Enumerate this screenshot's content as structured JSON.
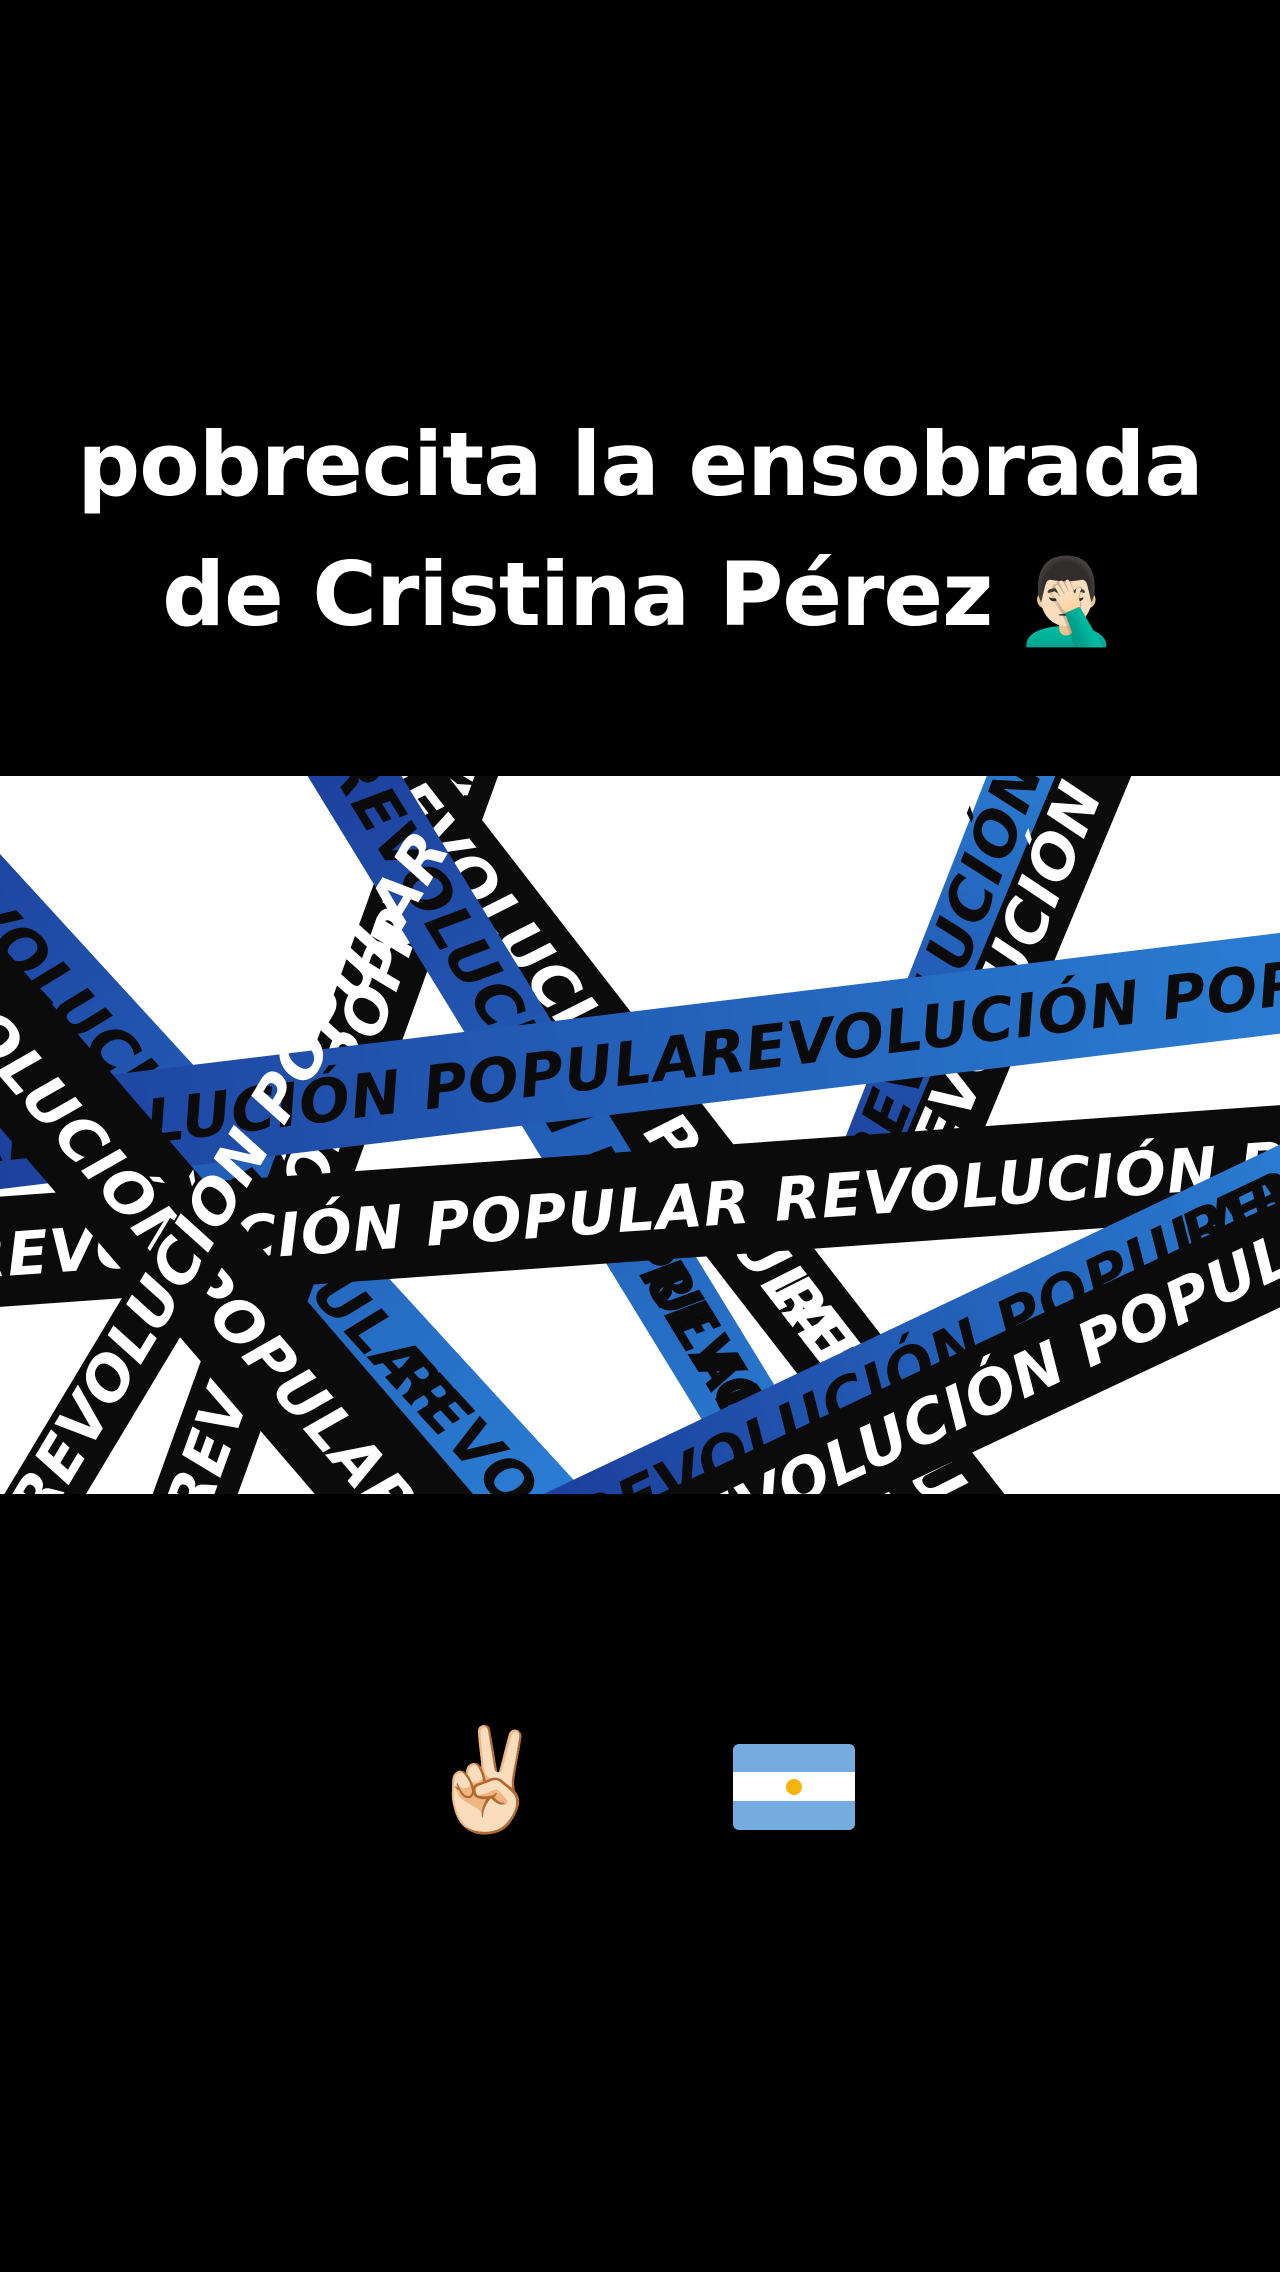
{
  "caption": {
    "line1": "pobrecita la ensobrada",
    "line2": "de Cristina Pérez",
    "emoji": "🤦🏻‍♂️"
  },
  "banner": {
    "tape_text": "REVOLUCIÓN POPULAR",
    "colors": {
      "blue": "#2a7fd4",
      "blue_dark": "#1c3f9c",
      "black": "#0b0b0b",
      "background": "#ffffff"
    }
  },
  "emoji_row": {
    "victory": "✌🏻",
    "sunglasses": "😎",
    "flag_icon": "argentina-flag",
    "flag_colors": [
      "#74acdf",
      "#ffffff",
      "#74acdf"
    ]
  }
}
